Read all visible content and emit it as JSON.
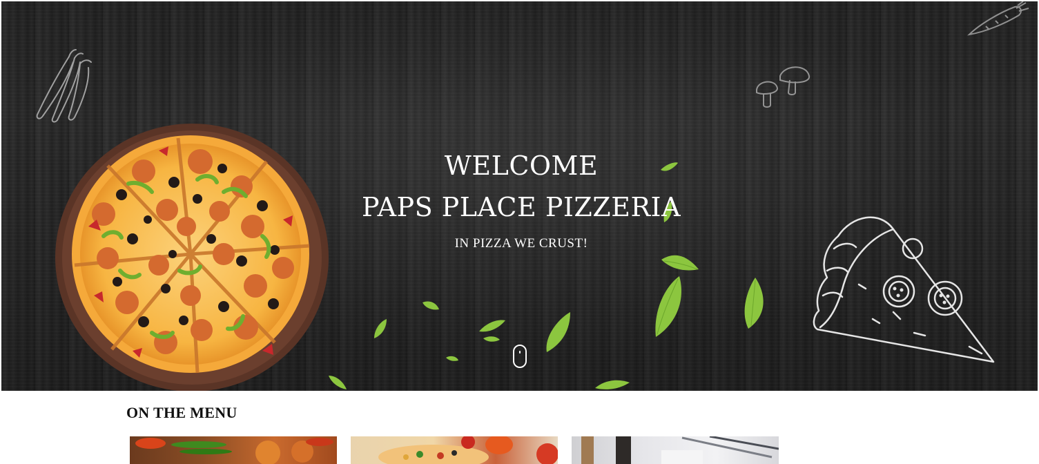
{
  "hero": {
    "title_line1": "WELCOME",
    "title_line2": "PAPS PLACE PIZZERIA",
    "subtitle": "IN PIZZA WE CRUST!"
  },
  "menu": {
    "heading": "ON THE MENU",
    "cards": [
      {
        "image": "pizza-with-peppers-photo"
      },
      {
        "image": "pizza-with-vegetables-photo"
      },
      {
        "image": "table-setting-photo"
      }
    ]
  },
  "colors": {
    "hero_text": "#ffffff",
    "wood_dark": "#2b2b2b",
    "leaf_green": "#8cc63f",
    "menu_heading": "#111111"
  },
  "icons": [
    "scroll-mouse-icon",
    "chili-peppers-doodle",
    "mushroom-doodle",
    "carrot-doodle",
    "pizza-slice-doodle"
  ]
}
